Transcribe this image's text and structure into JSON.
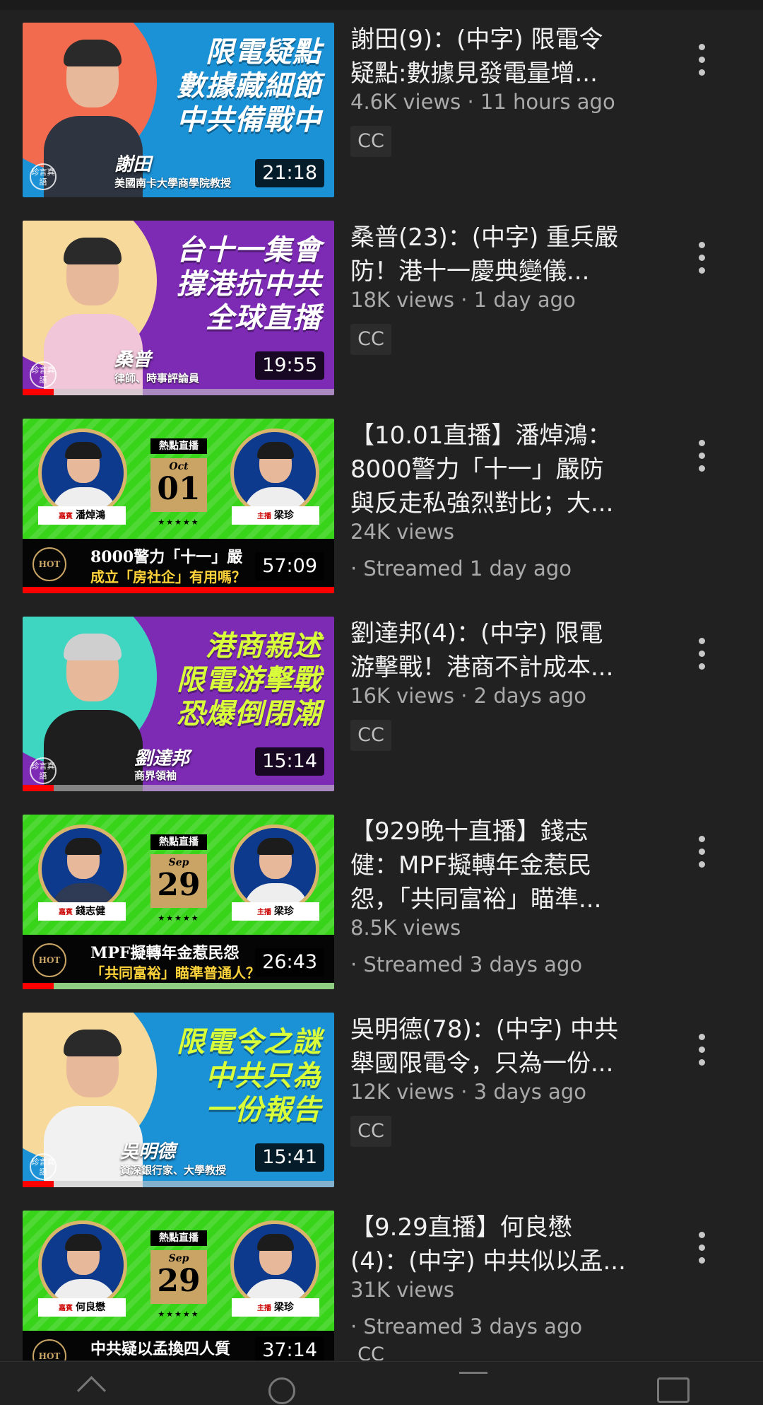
{
  "videos": [
    {
      "title": "謝田(9)：(中字) 限電令疑點:數據見發電量增...",
      "title_line1": "謝田(9)：(中字) 限電令",
      "title_line2": "疑點:數據見發電量增...",
      "meta": "4.6K views · 11 hours ago",
      "badge": "CC",
      "duration": "21:18",
      "thumb": {
        "headline": [
          "限電疑點",
          "數據藏細節",
          "中共備戰中"
        ],
        "name": "謝田",
        "subtitle": "美國南卡大學商學院教授",
        "logo": "珍言真語"
      }
    },
    {
      "title_line1": "桑普(23)：(中字) 重兵嚴",
      "title_line2": "防！港十一慶典變儀...",
      "meta": "18K views · 1 day ago",
      "badge": "CC",
      "duration": "19:55",
      "thumb": {
        "headline": [
          "台十一集會",
          "撐港抗中共",
          "全球直播"
        ],
        "name": "桑普",
        "subtitle": "律師、時事評論員",
        "logo": "珍言真語"
      }
    },
    {
      "title_line1": "【10.01直播】潘焯鴻：",
      "title_line2": "8000警力「十一」嚴防",
      "title_line3": "與反走私強烈對比；大...",
      "meta": "24K views",
      "streamed": "· Streamed 1 day ago",
      "duration": "57:09",
      "thumb": {
        "tag": "熱點直播",
        "month": "Oct",
        "day": "01",
        "guest": "潘焯鴻",
        "guest_role": "嘉賓",
        "host": "梁珍",
        "host_role": "主播",
        "banner1": "8000警力「十一」嚴",
        "banner2": "成立「房社企」有用嗎？",
        "hot": "HOT"
      }
    },
    {
      "title_line1": "劉達邦(4)：(中字) 限電",
      "title_line2": "游擊戰！港商不計成本...",
      "meta": "16K views · 2 days ago",
      "badge": "CC",
      "duration": "15:14",
      "thumb": {
        "headline": [
          "港商親述",
          "限電游擊戰",
          "恐爆倒閉潮"
        ],
        "name": "劉達邦",
        "subtitle": "商界領袖",
        "logo": "珍言真語"
      }
    },
    {
      "title_line1": "【929晚十直播】錢志",
      "title_line2": "健：MPF擬轉年金惹民",
      "title_line3": "怨，「共同富裕」瞄準...",
      "meta": "8.5K views",
      "streamed": "· Streamed 3 days ago",
      "duration": "26:43",
      "thumb": {
        "tag": "熱點直播",
        "month": "Sep",
        "day": "29",
        "guest": "錢志健",
        "guest_role": "嘉賓",
        "host": "梁珍",
        "host_role": "主播",
        "banner1": "MPF擬轉年金惹民怨",
        "banner2": "「共同富裕」瞄準普通人？",
        "hot": "HOT"
      }
    },
    {
      "title_line1": "吳明德(78)：(中字) 中共",
      "title_line2": "舉國限電令，只為一份...",
      "meta": "12K views · 3 days ago",
      "badge": "CC",
      "duration": "15:41",
      "thumb": {
        "headline": [
          "限電令之謎",
          "中共只為",
          "一份報告"
        ],
        "name": "吳明德",
        "subtitle": "資深銀行家、大學教授",
        "logo": "珍言真語"
      }
    },
    {
      "title_line1": "【9.29直播】何良懋",
      "title_line2": "(4)：(中字) 中共似以孟...",
      "meta": "31K views",
      "streamed": "· Streamed 3 days ago",
      "badge": "CC",
      "duration": "37:14",
      "thumb": {
        "tag": "熱點直播",
        "month": "Sep",
        "day": "29",
        "guest": "何良懋",
        "guest_role": "嘉賓",
        "host": "梁珍",
        "host_role": "主播",
        "banner1": "中共疑以孟換四人質",
        "banner2": "",
        "hot": "HOT"
      }
    }
  ],
  "colors": {
    "background": "#212121",
    "live_green": "#38d41a",
    "accent_red": "#ff0000",
    "thumb_blue": "#1b91d6",
    "thumb_purple": "#7d2bb4"
  },
  "icons": [
    "more-vert-icon",
    "home-icon",
    "explore-icon",
    "subscriptions-icon",
    "library-icon"
  ]
}
